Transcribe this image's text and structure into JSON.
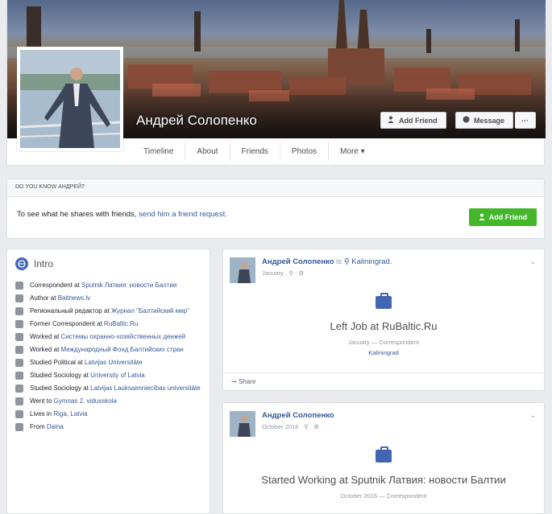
{
  "profile": {
    "name": "Андрей Солопенко"
  },
  "cover_actions": {
    "add_friend": "Add Friend",
    "message": "Message",
    "more": "···"
  },
  "nav": {
    "timeline": "Timeline",
    "about": "About",
    "friends": "Friends",
    "photos": "Photos",
    "more": "More ▾"
  },
  "friend_request": {
    "header": "Do you know Андрей?",
    "text": "To see what he shares with friends, ",
    "link": "send him a friend request.",
    "button": "Add Friend"
  },
  "intro": {
    "title": "Intro",
    "items": [
      {
        "prefix": "Correspondent at ",
        "link": "Sputnik Латвия: новости Балтии"
      },
      {
        "prefix": "Author at ",
        "link": "Baltnews.lv"
      },
      {
        "prefix": "Региональный редактор at ",
        "link": "Журнал \"Балтийский мир\""
      },
      {
        "prefix": "Former Correspondent at ",
        "link": "RuBaltic.Ru"
      },
      {
        "prefix": "Worked at ",
        "link": "Системы охранно-хозяйственных денжей"
      },
      {
        "prefix": "Worked at ",
        "link": "Международный Фонд Балтийских стран"
      },
      {
        "prefix": "Studied Political at ",
        "link": "Latvijas Universitāte"
      },
      {
        "prefix": "Studied Sociology at ",
        "link": "University of Latvia"
      },
      {
        "prefix": "Studied Sociology at ",
        "link": "Latvijas Lauksaimniecības universitāte"
      },
      {
        "prefix": "Went to ",
        "link": "Gymnas 2. vidusskola"
      },
      {
        "prefix": "Lives in ",
        "link": "Riga, Latvia"
      },
      {
        "prefix": "From ",
        "link": "Daina"
      }
    ]
  },
  "posts": [
    {
      "author": "Андрей Солопенко",
      "with": "is",
      "location": "Kaliningrad.",
      "date": "January · ⚲ · ⚙",
      "event_title": "Left Job at RuBaltic.Ru",
      "event_sub": "January — Correspondent",
      "event_loc": "Kaliningrad",
      "share": "Share"
    },
    {
      "author": "Андрей Солопенко",
      "date": "October 2016 · ⚲ · ⚙",
      "event_title": "Started Working at Sputnik Латвия: новости Балтии",
      "event_sub": "October 2016 — Correspondent"
    }
  ],
  "colors": {
    "fb_blue": "#4267b2",
    "link_blue": "#365899",
    "green": "#42b72a",
    "page_bg": "#e9ebee"
  }
}
